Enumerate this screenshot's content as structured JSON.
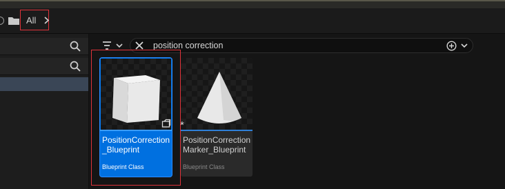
{
  "breadcrumb": {
    "root_label": "All"
  },
  "search": {
    "query": "position correction"
  },
  "assets": [
    {
      "name": "PositionCorrection_Blueprint",
      "class_label": "Blueprint Class",
      "thumbnail": "cube",
      "selected": true
    },
    {
      "name": "PositionCorrectionMarker_Blueprint",
      "class_label": "Blueprint Class",
      "thumbnail": "cone",
      "selected": false,
      "badge": "*"
    }
  ],
  "icons": {
    "history": "history-icon",
    "folder": "folder-icon",
    "breadcrumb_arrow": "chevron-right-icon",
    "filter": "filter-icon",
    "clear": "close-icon",
    "search": "search-icon",
    "add_filter": "plus-circle-icon",
    "dropdown": "chevron-down-icon",
    "asset_type": "blueprint-icon"
  },
  "colors": {
    "selection": "#0070e0",
    "highlight_outline": "#e0333a",
    "type_bar": "#2f80d8"
  }
}
